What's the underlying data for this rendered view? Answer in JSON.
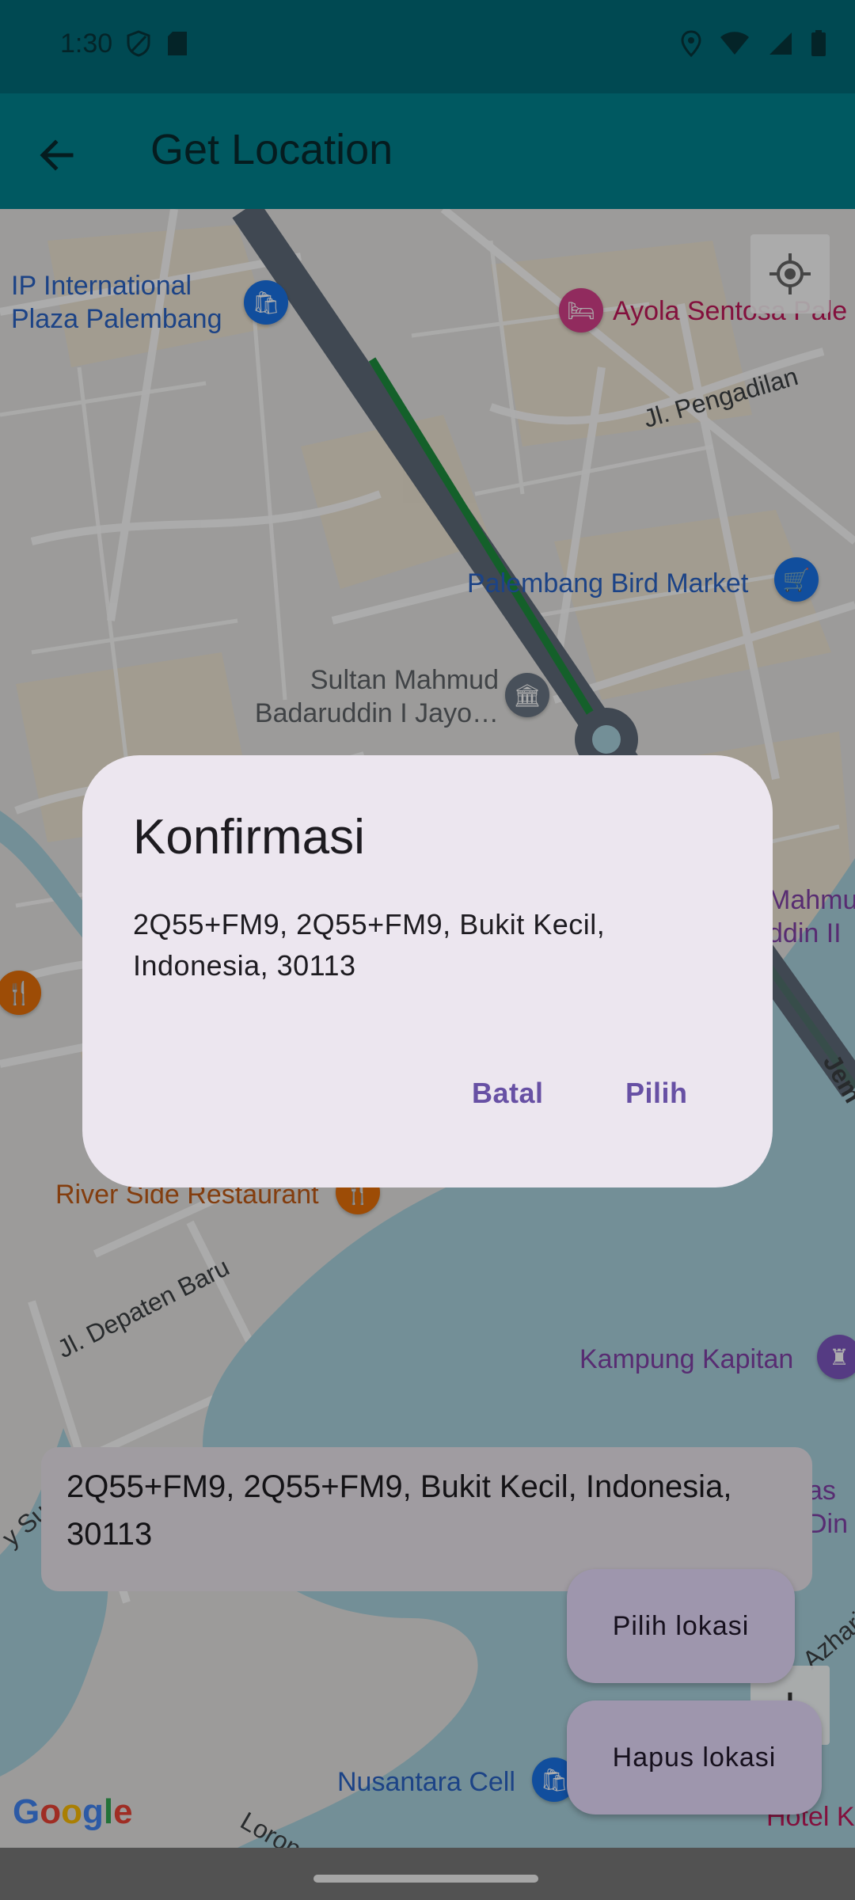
{
  "status_bar": {
    "time": "1:30",
    "left_icons": [
      "shield-icon",
      "sd-card-icon"
    ],
    "right_icons": [
      "location-icon",
      "wifi-icon",
      "signal-icon",
      "battery-icon"
    ]
  },
  "app_bar": {
    "title": "Get Location",
    "back_icon": "arrow-back-icon"
  },
  "map": {
    "places": [
      {
        "name": "IP International Plaza Palembang"
      },
      {
        "name": "Ayola Sentosa Pale"
      },
      {
        "name": "Palembang Bird Market"
      },
      {
        "name": "Sultan Mahmud Badaruddin I Jayo…"
      },
      {
        "name": "Mahmu ddin II"
      },
      {
        "name": "River Side Restaurant"
      },
      {
        "name": "Kampung Kapitan"
      },
      {
        "name": "Nusantara Cell"
      },
      {
        "name": "as Din"
      },
      {
        "name": "Hotel Ker"
      }
    ],
    "streets": [
      "Jl. Pengadilan",
      "Jl. Depaten Baru",
      "Jem",
      "Azhari",
      "Lorong",
      "y Su"
    ],
    "google_logo": "Google",
    "my_location_icon": "my-location-icon",
    "zoom_in_label": "+"
  },
  "address_card": {
    "text": "2Q55+FM9, 2Q55+FM9, Bukit Kecil, Indonesia, 30113"
  },
  "fabs": {
    "pilih_label": "Pilih lokasi",
    "hapus_label": "Hapus lokasi"
  },
  "dialog": {
    "title": "Konfirmasi",
    "body": "2Q55+FM9, 2Q55+FM9, Bukit Kecil, Indonesia, 30113",
    "cancel_label": "Batal",
    "confirm_label": "Pilih"
  },
  "colors": {
    "status_bar": "#006c7a",
    "app_bar": "#00838f",
    "dialog_bg": "#ece6ef",
    "dialog_button": "#6750a4",
    "fab_bg": "#e9ddff",
    "water": "#aad3df",
    "route": "#1e8e3e"
  }
}
